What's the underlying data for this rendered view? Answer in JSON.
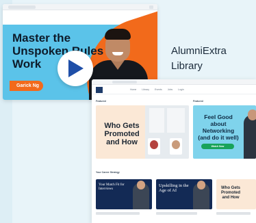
{
  "video": {
    "title": "Master the Unspoken Rules of Work",
    "presenter": "Garick Ng"
  },
  "caption": {
    "line1": "AlumniExtra",
    "line2": "Library"
  },
  "library": {
    "featured_left_label": "Featured",
    "featured_right_label": "Featured",
    "nav_links": [
      "Home",
      "Library",
      "Events",
      "Jobs",
      "Login"
    ],
    "cards": {
      "promoted_title": "Who Gets Promoted and How",
      "networking_title": "Feel Good about Networking (and do it well)",
      "networking_cta": "Watch Now"
    },
    "strategy_label": "Your Career Strategy",
    "strategy_cards": [
      {
        "title": "Your Match Fit for Interviews"
      },
      {
        "title": "Upskilling in the Age of AI"
      },
      {
        "title": "Who Gets Promoted and How"
      }
    ]
  },
  "colors": {
    "video_bg": "#5bc3e9",
    "video_accent": "#f26a1b",
    "page_bg": "#e8f4f9",
    "navy": "#132a55",
    "cta_green": "#18a35a"
  }
}
